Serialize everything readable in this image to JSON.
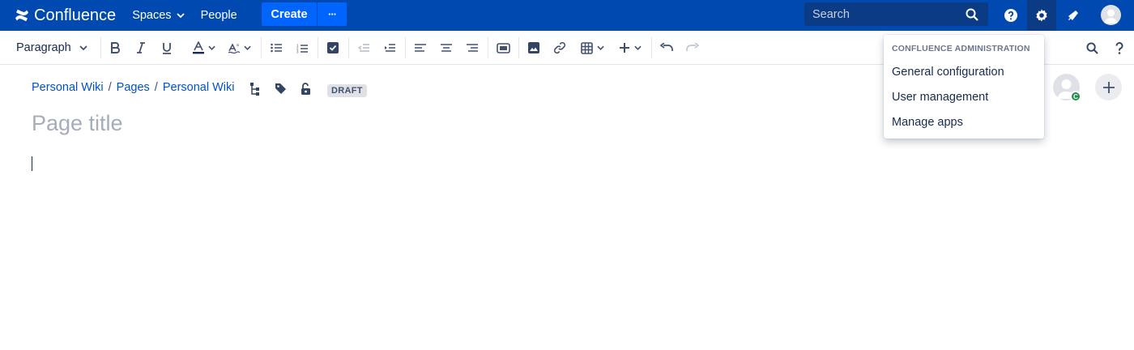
{
  "app": {
    "logo_text": "Confluence"
  },
  "topnav": {
    "spaces": "Spaces",
    "people": "People",
    "create": "Create",
    "more": "···",
    "search_placeholder": "Search"
  },
  "toolbar": {
    "paragraph": "Paragraph"
  },
  "breadcrumbs": {
    "items": [
      "Personal Wiki",
      "Pages",
      "Personal Wiki"
    ],
    "separator": "/"
  },
  "page": {
    "status": "DRAFT",
    "title_placeholder": "Page title"
  },
  "collaborator": {
    "badge": "C"
  },
  "admin_menu": {
    "heading": "CONFLUENCE ADMINISTRATION",
    "items": [
      "General configuration",
      "User management",
      "Manage apps"
    ]
  },
  "colors": {
    "nav_bg": "#0049b0",
    "create_bg": "#0065ff",
    "link": "#0052cc",
    "badge_green": "#1f8f4a"
  }
}
